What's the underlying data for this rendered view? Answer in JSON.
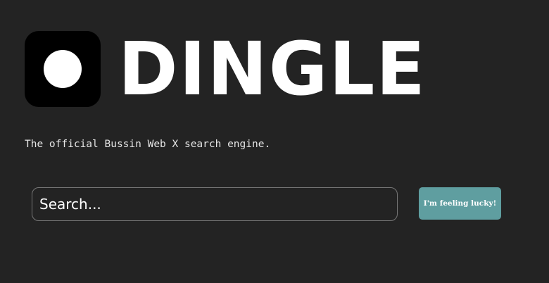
{
  "header": {
    "logo_icon": "circle-dot-logo",
    "title": "DINGLE"
  },
  "tagline": "The official Bussin Web X search engine.",
  "search": {
    "placeholder": "Search...",
    "value": ""
  },
  "lucky_button": {
    "label": "I'm feeling lucky!"
  },
  "colors": {
    "background": "#232323",
    "logo_background": "#000000",
    "button_accent": "#5f9ea0",
    "text": "#ffffff"
  }
}
